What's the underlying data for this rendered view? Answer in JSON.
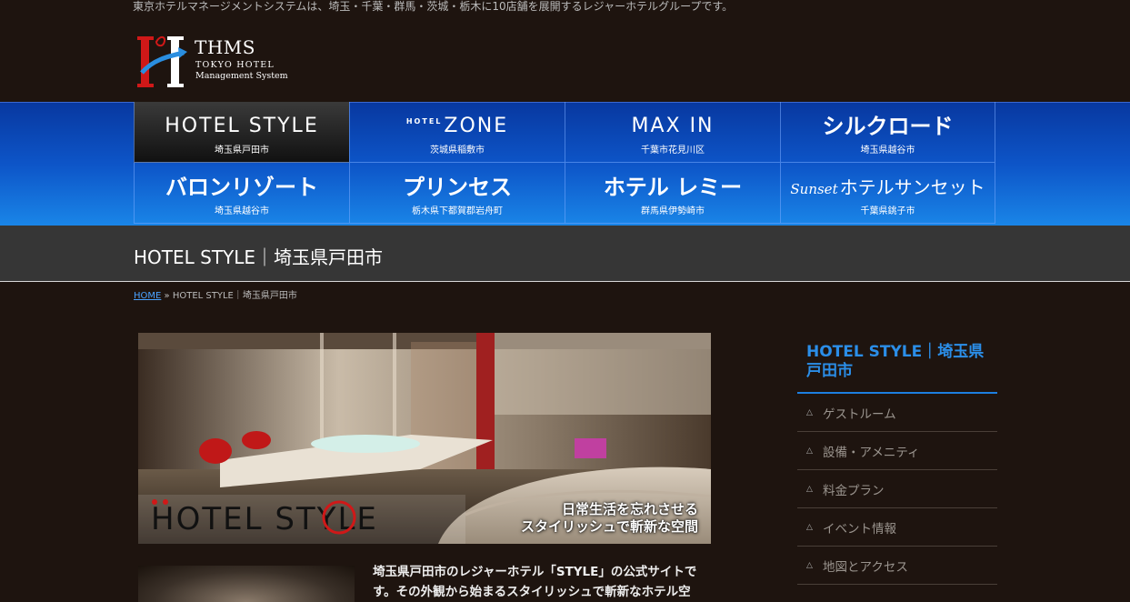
{
  "header": {
    "tagline": "東京ホテルマネージメントシステムは、埼玉・千葉・群馬・茨城・栃木に10店舗を展開するレジャーホテルグループです。",
    "logo": {
      "name": "THMS",
      "sub1": "TOKYO HOTEL",
      "sub2": "Management System"
    }
  },
  "nav": [
    {
      "brand": "HOTEL STYLE",
      "location": "埼玉県戸田市",
      "active": true
    },
    {
      "brand_small": "HOTEL",
      "brand": "ZONE",
      "location": "茨城県稲敷市"
    },
    {
      "brand": "MAX IN",
      "location": "千葉市花見川区"
    },
    {
      "brand": "シルクロード",
      "location": "埼玉県越谷市"
    },
    {
      "brand": "バロンリゾート",
      "location": "埼玉県越谷市"
    },
    {
      "brand": "プリンセス",
      "location": "栃木県下都賀郡岩舟町"
    },
    {
      "brand": "ホテル レミー",
      "location": "群馬県伊勢崎市"
    },
    {
      "brand_script": "Sunset",
      "brand": "ホテルサンセット",
      "location": "千葉県銚子市"
    }
  ],
  "page": {
    "title": "HOTEL STYLE｜埼玉県戸田市"
  },
  "breadcrumb": {
    "home": "HOME",
    "separator": "»",
    "current": "HOTEL STYLE｜埼玉県戸田市"
  },
  "hero": {
    "logo_text": "HOTEL STYLE",
    "catch_line1": "日常生活を忘れさせる",
    "catch_line2": "スタイリッシュで斬新な空間"
  },
  "intro": {
    "text": "埼玉県戸田市のレジャーホテル「STYLE」の公式サイトです。その外観から始まるスタイリッシュで斬新なホテル空"
  },
  "sidebar": {
    "title": "HOTEL STYLE｜埼玉県戸田市",
    "items": [
      {
        "label": "ゲストルーム"
      },
      {
        "label": "設備・アメニティ"
      },
      {
        "label": "料金プラン"
      },
      {
        "label": "イベント情報"
      },
      {
        "label": "地図とアクセス"
      }
    ]
  },
  "colors": {
    "background": "#1e140f",
    "nav_top": "#0838a0",
    "nav_bottom": "#1a86e8",
    "accent": "#2b8ee8",
    "titlebar": "#363636"
  }
}
